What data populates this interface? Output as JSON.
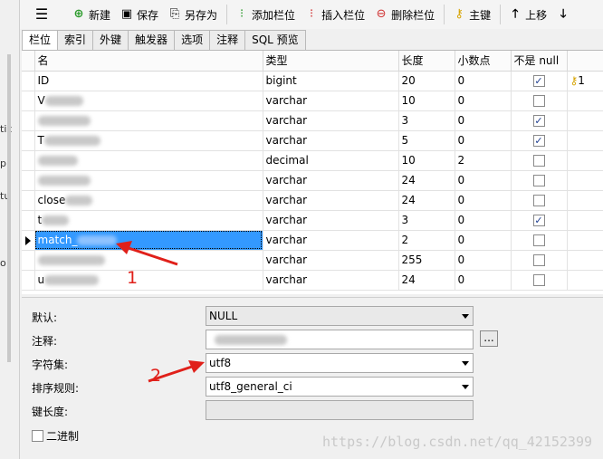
{
  "left_strip": {
    "labels": [
      "tic",
      "p",
      "tu",
      "o"
    ]
  },
  "toolbar": {
    "menu_icon": "hamburger-icon",
    "new_label": "新建",
    "save_label": "保存",
    "save_as_label": "另存为",
    "add_field_label": "添加栏位",
    "insert_field_label": "插入栏位",
    "delete_field_label": "删除栏位",
    "primary_key_label": "主键",
    "move_up_label": "上移"
  },
  "tabs": [
    {
      "label": "栏位"
    },
    {
      "label": "索引"
    },
    {
      "label": "外键"
    },
    {
      "label": "触发器"
    },
    {
      "label": "选项"
    },
    {
      "label": "注释"
    },
    {
      "label": "SQL 预览"
    }
  ],
  "grid": {
    "headers": [
      "名",
      "类型",
      "长度",
      "小数点",
      "不是 null"
    ],
    "rows": [
      {
        "name": "ID",
        "type": "bigint",
        "length": "20",
        "decimals": "0",
        "not_null": true,
        "key": "1"
      },
      {
        "name": "V",
        "type": "varchar",
        "length": "10",
        "decimals": "0",
        "not_null": false
      },
      {
        "name": "",
        "type": "varchar",
        "length": "3",
        "decimals": "0",
        "not_null": true
      },
      {
        "name": "T",
        "type": "varchar",
        "length": "5",
        "decimals": "0",
        "not_null": true
      },
      {
        "name": "",
        "type": "decimal",
        "length": "10",
        "decimals": "2",
        "not_null": false
      },
      {
        "name": "",
        "type": "varchar",
        "length": "24",
        "decimals": "0",
        "not_null": false
      },
      {
        "name": "close",
        "type": "varchar",
        "length": "24",
        "decimals": "0",
        "not_null": false
      },
      {
        "name": "t",
        "type": "varchar",
        "length": "3",
        "decimals": "0",
        "not_null": true
      },
      {
        "name": "match_",
        "type": "varchar",
        "length": "2",
        "decimals": "0",
        "not_null": false,
        "selected": true
      },
      {
        "name": "",
        "type": "varchar",
        "length": "255",
        "decimals": "0",
        "not_null": false
      },
      {
        "name": "u",
        "type": "varchar",
        "length": "24",
        "decimals": "0",
        "not_null": false
      }
    ]
  },
  "props": {
    "default_label": "默认:",
    "default_value": "NULL",
    "comment_label": "注释:",
    "comment_value": "",
    "ellipsis_label": "...",
    "charset_label": "字符集:",
    "charset_value": "utf8",
    "collation_label": "排序规则:",
    "collation_value": "utf8_general_ci",
    "key_length_label": "键长度:",
    "binary_label": "二进制"
  },
  "annotations": {
    "one": "1",
    "two": "2",
    "color": "#e0201a"
  },
  "watermark": "https://blog.csdn.net/qq_42152399"
}
